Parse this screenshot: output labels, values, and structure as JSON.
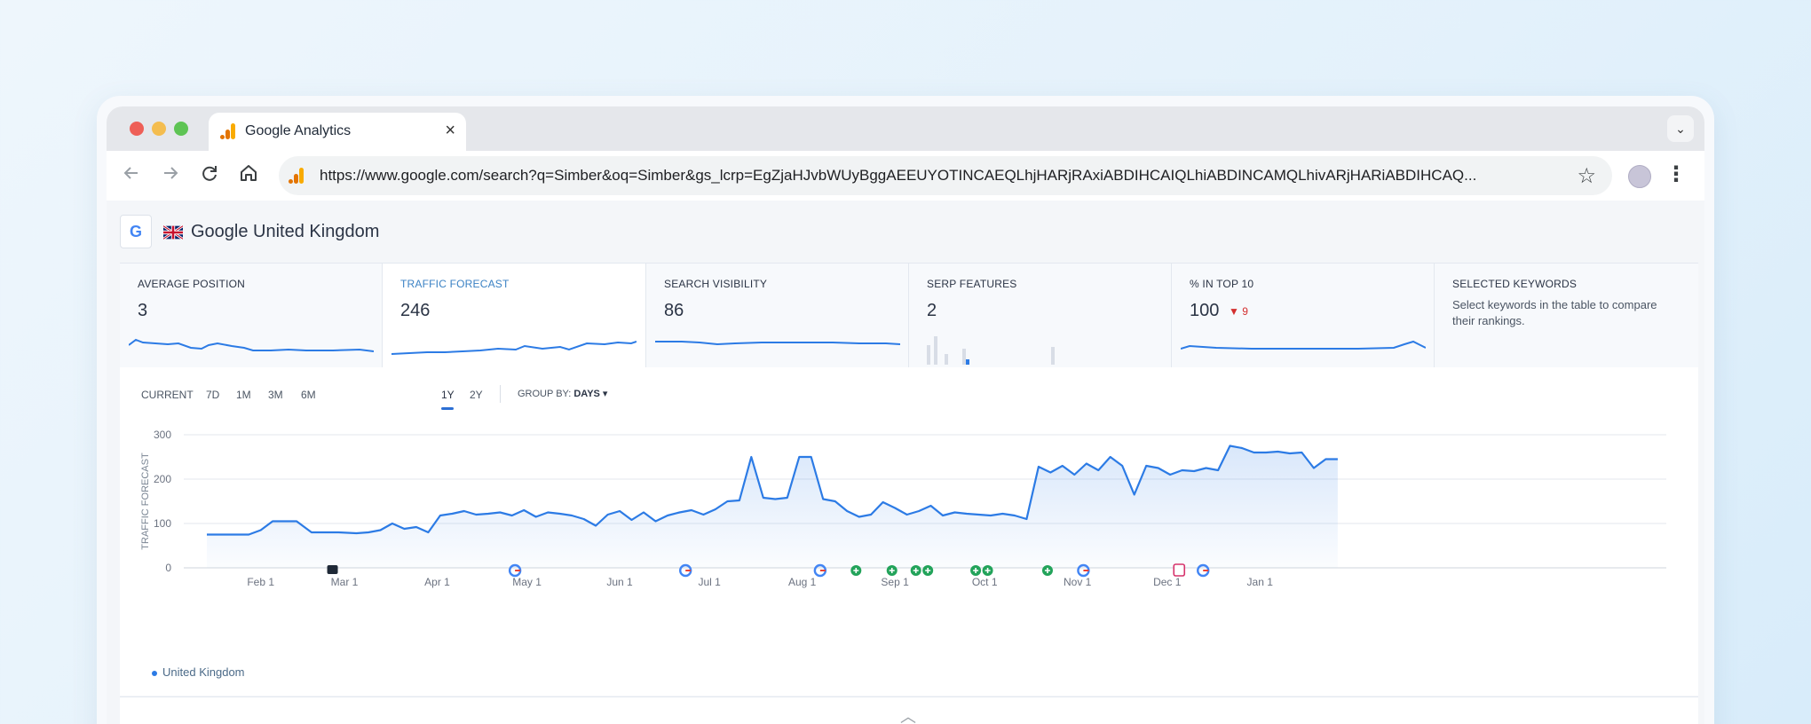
{
  "browser": {
    "tab_title": "Google Analytics",
    "tab_close": "×",
    "tab_dropdown": "⌄",
    "url": "https://www.google.com/search?q=Simber&oq=Simber&gs_lcrp=EgZjaHJvbWUyBggAEEUYOTINCAEQLhjHARjRAxiABDIHCAIQLhiABDINCAMQLhivARjHARiABDIHCAQ...",
    "back_icon": "arrow-left-icon",
    "forward_icon": "arrow-right-icon",
    "reload_icon": "reload-icon",
    "home_icon": "home-icon",
    "bookmark_icon": "star-icon"
  },
  "header": {
    "search_engine_badge": "G",
    "region": "Google United Kingdom"
  },
  "metrics": [
    {
      "label": "AVERAGE POSITION",
      "value": "3"
    },
    {
      "label": "TRAFFIC FORECAST",
      "value": "246"
    },
    {
      "label": "SEARCH VISIBILITY",
      "value": "86"
    },
    {
      "label": "SERP FEATURES",
      "value": "2"
    },
    {
      "label": "% IN TOP 10",
      "value": "100",
      "delta": "▼ 9"
    },
    {
      "label": "SELECTED KEYWORDS",
      "description": "Select keywords in the table to compare their rankings."
    }
  ],
  "ranges": [
    "CURRENT",
    "7D",
    "1M",
    "3M",
    "6M",
    "1Y",
    "2Y"
  ],
  "selected_range": "1Y",
  "group_by": {
    "label": "GROUP BY:",
    "value": "DAYS ▾"
  },
  "colors": {
    "accent": "#2c7be5",
    "active_metric_label": "#3b82c4",
    "delta_down": "#d32f2f"
  },
  "chart_data": {
    "type": "area",
    "title": "",
    "xlabel": "",
    "ylabel": "TRAFFIC FORECAST",
    "ylim": [
      0,
      300
    ],
    "yticks": [
      0,
      100,
      200,
      300
    ],
    "xticks": [
      "Feb 1",
      "Mar 1",
      "Apr 1",
      "May 1",
      "Jun 1",
      "Jul 1",
      "Aug 1",
      "Sep 1",
      "Oct 1",
      "Nov 1",
      "Dec 1",
      "Jan 1"
    ],
    "grid": true,
    "legend": "bottom-left",
    "series": [
      {
        "name": "United Kingdom",
        "x_day": [
          0,
          14,
          18,
          22,
          26,
          30,
          35,
          40,
          44,
          50,
          54,
          58,
          62,
          66,
          70,
          74,
          78,
          82,
          86,
          90,
          94,
          98,
          102,
          106,
          110,
          114,
          118,
          122,
          126,
          130,
          134,
          138,
          142,
          146,
          150,
          154,
          158,
          162,
          166,
          170,
          174,
          178,
          182,
          186,
          190,
          194,
          198,
          202,
          206,
          210,
          214,
          218,
          222,
          226,
          230,
          234,
          238,
          242,
          246,
          250,
          254,
          258,
          262,
          266,
          270,
          274,
          278,
          282,
          286,
          290,
          294,
          298,
          302,
          306,
          310,
          314,
          318,
          322,
          326,
          330,
          334,
          338,
          342,
          346,
          350,
          354,
          358,
          362,
          366,
          370,
          374,
          378
        ],
        "values": [
          75,
          75,
          85,
          105,
          105,
          105,
          80,
          80,
          80,
          78,
          80,
          85,
          100,
          88,
          92,
          80,
          118,
          122,
          128,
          120,
          122,
          125,
          118,
          130,
          115,
          125,
          122,
          118,
          110,
          95,
          120,
          128,
          108,
          125,
          105,
          118,
          125,
          130,
          120,
          132,
          150,
          152,
          250,
          158,
          155,
          158,
          250,
          250,
          155,
          150,
          128,
          115,
          120,
          148,
          135,
          120,
          128,
          140,
          118,
          125,
          122,
          120,
          118,
          122,
          118,
          110,
          228,
          215,
          230,
          210,
          235,
          220,
          250,
          230,
          165,
          230,
          225,
          210,
          220,
          218,
          225,
          220,
          275,
          270,
          260,
          260,
          262,
          258,
          260,
          225,
          245,
          245
        ]
      }
    ]
  },
  "event_markers": [
    {
      "type": "note",
      "day": 42
    },
    {
      "type": "google",
      "day": 103
    },
    {
      "type": "google",
      "day": 160
    },
    {
      "type": "google",
      "day": 205
    },
    {
      "type": "plus",
      "day": 217
    },
    {
      "type": "plus",
      "day": 229
    },
    {
      "type": "plus",
      "day": 237
    },
    {
      "type": "plus",
      "day": 241
    },
    {
      "type": "plus",
      "day": 257
    },
    {
      "type": "plus",
      "day": 261
    },
    {
      "type": "plus",
      "day": 281
    },
    {
      "type": "google",
      "day": 293
    },
    {
      "type": "serp",
      "day": 325
    },
    {
      "type": "google",
      "day": 333
    }
  ],
  "collapse_icon": "chevron-up-icon"
}
